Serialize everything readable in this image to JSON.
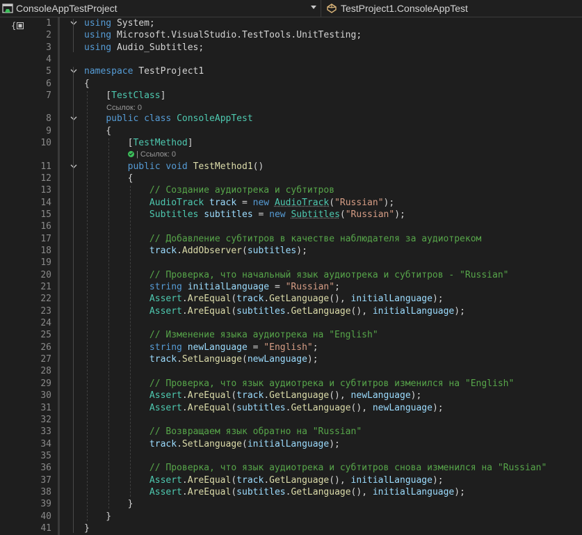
{
  "nav": {
    "project": "ConsoleAppTestProject",
    "type": "TestProject1.ConsoleAppTest"
  },
  "lens": {
    "refs_class": "Ссылок: 0",
    "refs_method": "| Ссылок: 0"
  },
  "lines": [
    {
      "n": "1",
      "segs": [
        {
          "t": "using",
          "c": "kw"
        },
        {
          "t": " System;"
        }
      ]
    },
    {
      "n": "2",
      "segs": [
        {
          "t": "using",
          "c": "kw"
        },
        {
          "t": " Microsoft.VisualStudio.TestTools.UnitTesting;"
        }
      ]
    },
    {
      "n": "3",
      "segs": [
        {
          "t": "using",
          "c": "kw"
        },
        {
          "t": " Audio_Subtitles;"
        }
      ]
    },
    {
      "n": "4",
      "segs": []
    },
    {
      "n": "5",
      "segs": [
        {
          "t": "namespace",
          "c": "kw"
        },
        {
          "t": " TestProject1"
        }
      ]
    },
    {
      "n": "6",
      "segs": [
        {
          "t": "{"
        }
      ]
    },
    {
      "n": "7",
      "segs": [
        {
          "t": "    ["
        },
        {
          "t": "TestClass",
          "c": "ty"
        },
        {
          "t": "]"
        }
      ]
    },
    {
      "n": "8",
      "segs": [
        {
          "t": "    "
        },
        {
          "t": "public",
          "c": "kw"
        },
        {
          "t": " "
        },
        {
          "t": "class",
          "c": "kw"
        },
        {
          "t": " "
        },
        {
          "t": "ConsoleAppTest",
          "c": "ty"
        }
      ]
    },
    {
      "n": "9",
      "segs": [
        {
          "t": "    {"
        }
      ]
    },
    {
      "n": "10",
      "segs": [
        {
          "t": "        ["
        },
        {
          "t": "TestMethod",
          "c": "ty"
        },
        {
          "t": "]"
        }
      ]
    },
    {
      "n": "11",
      "segs": [
        {
          "t": "        "
        },
        {
          "t": "public",
          "c": "kw"
        },
        {
          "t": " "
        },
        {
          "t": "void",
          "c": "kw"
        },
        {
          "t": " "
        },
        {
          "t": "TestMethod1",
          "c": "mt"
        },
        {
          "t": "()"
        }
      ]
    },
    {
      "n": "12",
      "segs": [
        {
          "t": "        {"
        }
      ]
    },
    {
      "n": "13",
      "segs": [
        {
          "t": "            // Создание аудиотрека и субтитров",
          "c": "cm"
        }
      ]
    },
    {
      "n": "14",
      "segs": [
        {
          "t": "            "
        },
        {
          "t": "AudioTrack",
          "c": "ty"
        },
        {
          "t": " "
        },
        {
          "t": "track",
          "c": "vr"
        },
        {
          "t": " = "
        },
        {
          "t": "new",
          "c": "kw"
        },
        {
          "t": " "
        },
        {
          "t": "AudioTrack",
          "c": "ty sq"
        },
        {
          "t": "("
        },
        {
          "t": "\"Russian\"",
          "c": "str"
        },
        {
          "t": ");"
        }
      ]
    },
    {
      "n": "15",
      "segs": [
        {
          "t": "            "
        },
        {
          "t": "Subtitles",
          "c": "ty"
        },
        {
          "t": " "
        },
        {
          "t": "subtitles",
          "c": "vr"
        },
        {
          "t": " = "
        },
        {
          "t": "new",
          "c": "kw"
        },
        {
          "t": " "
        },
        {
          "t": "Subtitles",
          "c": "ty sq"
        },
        {
          "t": "("
        },
        {
          "t": "\"Russian\"",
          "c": "str"
        },
        {
          "t": ");"
        }
      ]
    },
    {
      "n": "16",
      "segs": []
    },
    {
      "n": "17",
      "segs": [
        {
          "t": "            // Добавление субтитров в качестве наблюдателя за аудиотреком",
          "c": "cm"
        }
      ]
    },
    {
      "n": "18",
      "segs": [
        {
          "t": "            "
        },
        {
          "t": "track",
          "c": "vr"
        },
        {
          "t": "."
        },
        {
          "t": "AddObserver",
          "c": "mt"
        },
        {
          "t": "("
        },
        {
          "t": "subtitles",
          "c": "vr"
        },
        {
          "t": ");"
        }
      ]
    },
    {
      "n": "19",
      "segs": []
    },
    {
      "n": "20",
      "segs": [
        {
          "t": "            // Проверка, что начальный язык аудиотрека и субтитров - \"Russian\"",
          "c": "cm"
        }
      ]
    },
    {
      "n": "21",
      "segs": [
        {
          "t": "            "
        },
        {
          "t": "string",
          "c": "kw"
        },
        {
          "t": " "
        },
        {
          "t": "initialLanguage",
          "c": "vr"
        },
        {
          "t": " = "
        },
        {
          "t": "\"Russian\"",
          "c": "str"
        },
        {
          "t": ";"
        }
      ]
    },
    {
      "n": "22",
      "segs": [
        {
          "t": "            "
        },
        {
          "t": "Assert",
          "c": "ty"
        },
        {
          "t": "."
        },
        {
          "t": "AreEqual",
          "c": "mt"
        },
        {
          "t": "("
        },
        {
          "t": "track",
          "c": "vr"
        },
        {
          "t": "."
        },
        {
          "t": "GetLanguage",
          "c": "mt"
        },
        {
          "t": "(), "
        },
        {
          "t": "initialLanguage",
          "c": "vr"
        },
        {
          "t": ");"
        }
      ]
    },
    {
      "n": "23",
      "segs": [
        {
          "t": "            "
        },
        {
          "t": "Assert",
          "c": "ty"
        },
        {
          "t": "."
        },
        {
          "t": "AreEqual",
          "c": "mt"
        },
        {
          "t": "("
        },
        {
          "t": "subtitles",
          "c": "vr"
        },
        {
          "t": "."
        },
        {
          "t": "GetLanguage",
          "c": "mt"
        },
        {
          "t": "(), "
        },
        {
          "t": "initialLanguage",
          "c": "vr"
        },
        {
          "t": ");"
        }
      ]
    },
    {
      "n": "24",
      "segs": []
    },
    {
      "n": "25",
      "segs": [
        {
          "t": "            // Изменение языка аудиотрека на \"English\"",
          "c": "cm"
        }
      ]
    },
    {
      "n": "26",
      "segs": [
        {
          "t": "            "
        },
        {
          "t": "string",
          "c": "kw"
        },
        {
          "t": " "
        },
        {
          "t": "newLanguage",
          "c": "vr"
        },
        {
          "t": " = "
        },
        {
          "t": "\"English\"",
          "c": "str"
        },
        {
          "t": ";"
        }
      ]
    },
    {
      "n": "27",
      "segs": [
        {
          "t": "            "
        },
        {
          "t": "track",
          "c": "vr"
        },
        {
          "t": "."
        },
        {
          "t": "SetLanguage",
          "c": "mt"
        },
        {
          "t": "("
        },
        {
          "t": "newLanguage",
          "c": "vr"
        },
        {
          "t": ");"
        }
      ]
    },
    {
      "n": "28",
      "segs": []
    },
    {
      "n": "29",
      "segs": [
        {
          "t": "            // Проверка, что язык аудиотрека и субтитров изменился на \"English\"",
          "c": "cm"
        }
      ]
    },
    {
      "n": "30",
      "segs": [
        {
          "t": "            "
        },
        {
          "t": "Assert",
          "c": "ty"
        },
        {
          "t": "."
        },
        {
          "t": "AreEqual",
          "c": "mt"
        },
        {
          "t": "("
        },
        {
          "t": "track",
          "c": "vr"
        },
        {
          "t": "."
        },
        {
          "t": "GetLanguage",
          "c": "mt"
        },
        {
          "t": "(), "
        },
        {
          "t": "newLanguage",
          "c": "vr"
        },
        {
          "t": ");"
        }
      ]
    },
    {
      "n": "31",
      "segs": [
        {
          "t": "            "
        },
        {
          "t": "Assert",
          "c": "ty"
        },
        {
          "t": "."
        },
        {
          "t": "AreEqual",
          "c": "mt"
        },
        {
          "t": "("
        },
        {
          "t": "subtitles",
          "c": "vr"
        },
        {
          "t": "."
        },
        {
          "t": "GetLanguage",
          "c": "mt"
        },
        {
          "t": "(), "
        },
        {
          "t": "newLanguage",
          "c": "vr"
        },
        {
          "t": ");"
        }
      ]
    },
    {
      "n": "32",
      "segs": []
    },
    {
      "n": "33",
      "segs": [
        {
          "t": "            // Возвращаем язык обратно на \"Russian\"",
          "c": "cm"
        }
      ]
    },
    {
      "n": "34",
      "segs": [
        {
          "t": "            "
        },
        {
          "t": "track",
          "c": "vr"
        },
        {
          "t": "."
        },
        {
          "t": "SetLanguage",
          "c": "mt"
        },
        {
          "t": "("
        },
        {
          "t": "initialLanguage",
          "c": "vr"
        },
        {
          "t": ");"
        }
      ]
    },
    {
      "n": "35",
      "segs": []
    },
    {
      "n": "36",
      "segs": [
        {
          "t": "            // Проверка, что язык аудиотрека и субтитров снова изменился на \"Russian\"",
          "c": "cm"
        }
      ]
    },
    {
      "n": "37",
      "segs": [
        {
          "t": "            "
        },
        {
          "t": "Assert",
          "c": "ty"
        },
        {
          "t": "."
        },
        {
          "t": "AreEqual",
          "c": "mt"
        },
        {
          "t": "("
        },
        {
          "t": "track",
          "c": "vr"
        },
        {
          "t": "."
        },
        {
          "t": "GetLanguage",
          "c": "mt"
        },
        {
          "t": "(), "
        },
        {
          "t": "initialLanguage",
          "c": "vr"
        },
        {
          "t": ");"
        }
      ]
    },
    {
      "n": "38",
      "segs": [
        {
          "t": "            "
        },
        {
          "t": "Assert",
          "c": "ty"
        },
        {
          "t": "."
        },
        {
          "t": "AreEqual",
          "c": "mt"
        },
        {
          "t": "("
        },
        {
          "t": "subtitles",
          "c": "vr"
        },
        {
          "t": "."
        },
        {
          "t": "GetLanguage",
          "c": "mt"
        },
        {
          "t": "(), "
        },
        {
          "t": "initialLanguage",
          "c": "vr"
        },
        {
          "t": ");"
        }
      ]
    },
    {
      "n": "39",
      "segs": [
        {
          "t": "        }"
        }
      ]
    },
    {
      "n": "40",
      "segs": [
        {
          "t": "    }"
        }
      ]
    },
    {
      "n": "41",
      "segs": [
        {
          "t": "}"
        }
      ]
    }
  ]
}
